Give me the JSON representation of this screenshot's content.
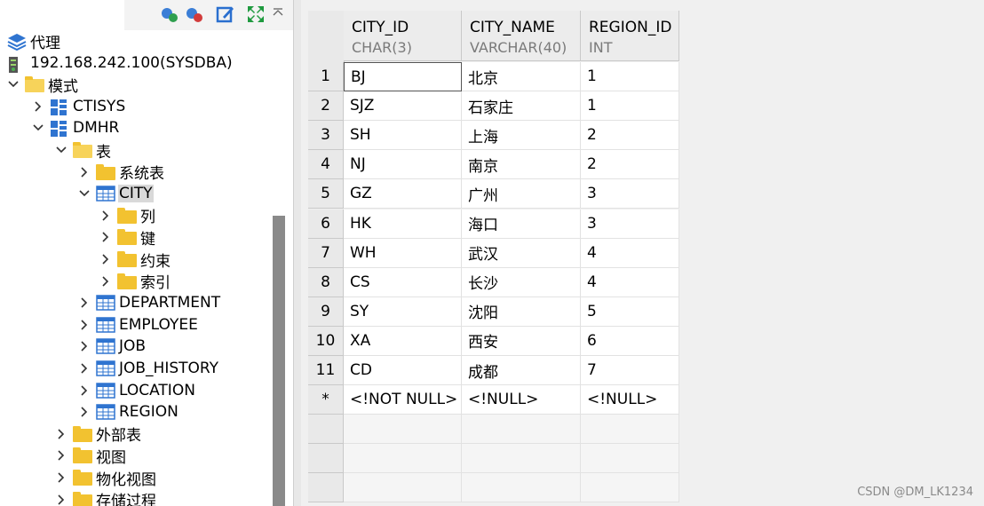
{
  "tree": {
    "items": [
      {
        "label": "代理",
        "icon": "layers-icon",
        "indent": 0
      },
      {
        "label": "192.168.242.100(SYSDBA)",
        "icon": "server-icon",
        "indent": 0
      },
      {
        "label": "模式",
        "icon": "folder-icon",
        "indent": 1,
        "expanded": true
      },
      {
        "label": "CTISYS",
        "icon": "schema-icon",
        "indent": 2
      },
      {
        "label": "DMHR",
        "icon": "schema-icon",
        "indent": 2,
        "expanded": true
      },
      {
        "label": "表",
        "icon": "folder-icon",
        "indent": 3,
        "expanded": true
      },
      {
        "label": "系统表",
        "icon": "folder-icon",
        "indent": 4
      },
      {
        "label": "CITY",
        "icon": "table-icon",
        "indent": 4,
        "expanded": true,
        "selected": true
      },
      {
        "label": "列",
        "icon": "folder-icon",
        "indent": 5
      },
      {
        "label": "键",
        "icon": "folder-icon",
        "indent": 5
      },
      {
        "label": "约束",
        "icon": "folder-icon",
        "indent": 5
      },
      {
        "label": "索引",
        "icon": "folder-icon",
        "indent": 5
      },
      {
        "label": "DEPARTMENT",
        "icon": "table-icon",
        "indent": 4
      },
      {
        "label": "EMPLOYEE",
        "icon": "table-icon",
        "indent": 4
      },
      {
        "label": "JOB",
        "icon": "table-icon",
        "indent": 4
      },
      {
        "label": "JOB_HISTORY",
        "icon": "table-icon",
        "indent": 4
      },
      {
        "label": "LOCATION",
        "icon": "table-icon",
        "indent": 4
      },
      {
        "label": "REGION",
        "icon": "table-icon",
        "indent": 4
      },
      {
        "label": "外部表",
        "icon": "folder-icon",
        "indent": 3
      },
      {
        "label": "视图",
        "icon": "folder-icon",
        "indent": 3
      },
      {
        "label": "物化视图",
        "icon": "folder-icon",
        "indent": 3
      },
      {
        "label": "存储过程",
        "icon": "folder-icon",
        "indent": 3
      }
    ]
  },
  "toolbar": {
    "icons": [
      "connect-icon",
      "disconnect-icon",
      "edit-icon",
      "expand-icon",
      "collapse-arrow-icon"
    ]
  },
  "grid": {
    "columns": [
      {
        "name": "CITY_ID",
        "type": "CHAR(3)"
      },
      {
        "name": "CITY_NAME",
        "type": "VARCHAR(40)"
      },
      {
        "name": "REGION_ID",
        "type": "INT"
      }
    ],
    "rows": [
      {
        "n": "1",
        "cells": [
          "BJ",
          "北京",
          "1"
        ]
      },
      {
        "n": "2",
        "cells": [
          "SJZ",
          "石家庄",
          "1"
        ]
      },
      {
        "n": "3",
        "cells": [
          "SH",
          "上海",
          "2"
        ]
      },
      {
        "n": "4",
        "cells": [
          "NJ",
          "南京",
          "2"
        ]
      },
      {
        "n": "5",
        "cells": [
          "GZ",
          "广州",
          "3"
        ]
      },
      {
        "n": "6",
        "cells": [
          "HK",
          "海口",
          "3"
        ]
      },
      {
        "n": "7",
        "cells": [
          "WH",
          "武汉",
          "4"
        ]
      },
      {
        "n": "8",
        "cells": [
          "CS",
          "长沙",
          "4"
        ]
      },
      {
        "n": "9",
        "cells": [
          "SY",
          "沈阳",
          "5"
        ]
      },
      {
        "n": "10",
        "cells": [
          "XA",
          "西安",
          "6"
        ]
      },
      {
        "n": "11",
        "cells": [
          "CD",
          "成都",
          "7"
        ]
      },
      {
        "n": "*",
        "cells": [
          "<!NOT NULL>",
          "<!NULL>",
          "<!NULL>"
        ]
      }
    ]
  },
  "watermark": "CSDN @DM_LK1234",
  "colors": {
    "folder": "#f2c230",
    "table_border": "#3a7bd5",
    "selection": "#d9d9d9"
  }
}
